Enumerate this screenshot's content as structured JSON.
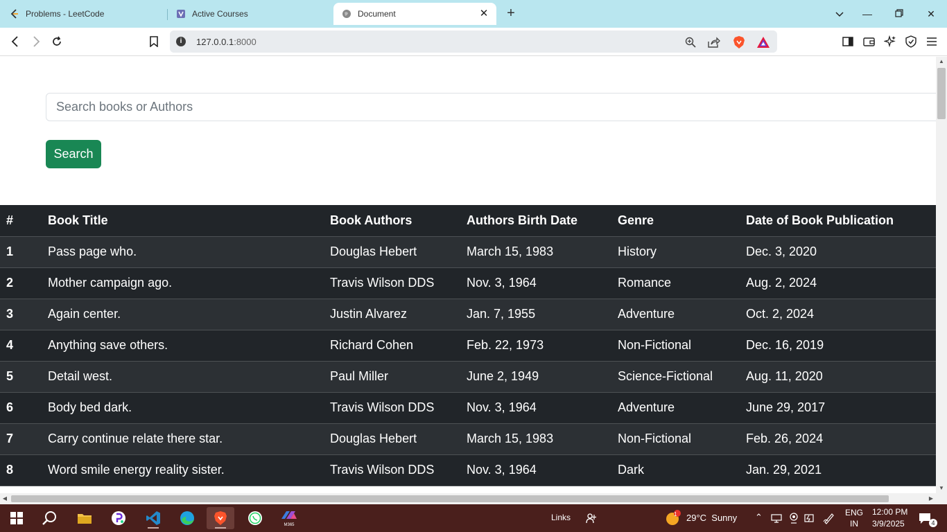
{
  "browser": {
    "tabs": [
      {
        "title": "Problems - LeetCode",
        "icon": "leetcode-icon"
      },
      {
        "title": "Active Courses",
        "icon": "courses-icon"
      },
      {
        "title": "Document",
        "icon": "globe-icon",
        "active": true
      }
    ],
    "url_host": "127.0.0.1",
    "url_port": ":8000"
  },
  "page": {
    "search_placeholder": "Search books or Authors",
    "search_button": "Search"
  },
  "table": {
    "headers": [
      "#",
      "Book Title",
      "Book Authors",
      "Authors Birth Date",
      "Genre",
      "Date of Book Publication"
    ],
    "rows": [
      [
        "1",
        "Pass page who.",
        "Douglas Hebert",
        "March 15, 1983",
        "History",
        "Dec. 3, 2020"
      ],
      [
        "2",
        "Mother campaign ago.",
        "Travis Wilson DDS",
        "Nov. 3, 1964",
        "Romance",
        "Aug. 2, 2024"
      ],
      [
        "3",
        "Again center.",
        "Justin Alvarez",
        "Jan. 7, 1955",
        "Adventure",
        "Oct. 2, 2024"
      ],
      [
        "4",
        "Anything save others.",
        "Richard Cohen",
        "Feb. 22, 1973",
        "Non-Fictional",
        "Dec. 16, 2019"
      ],
      [
        "5",
        "Detail west.",
        "Paul Miller",
        "June 2, 1949",
        "Science-Fictional",
        "Aug. 11, 2020"
      ],
      [
        "6",
        "Body bed dark.",
        "Travis Wilson DDS",
        "Nov. 3, 1964",
        "Adventure",
        "June 29, 2017"
      ],
      [
        "7",
        "Carry continue relate there star.",
        "Douglas Hebert",
        "March 15, 1983",
        "Non-Fictional",
        "Feb. 26, 2024"
      ],
      [
        "8",
        "Word smile energy reality sister.",
        "Travis Wilson DDS",
        "Nov. 3, 1964",
        "Dark",
        "Jan. 29, 2021"
      ]
    ]
  },
  "taskbar": {
    "links_label": "Links",
    "weather": "29°C  Sunny",
    "weather_badge": "1",
    "lang_1": "ENG",
    "lang_2": "IN",
    "time": "12:00 PM",
    "date": "3/9/2025",
    "notif_count": "4",
    "m365_label": "M365"
  },
  "colors": {
    "tabstrip": "#b9e6ef",
    "search_button": "#198754",
    "table_dark": "#212529",
    "table_stripe": "#2c3034",
    "taskbar": "#4a1f1c"
  }
}
